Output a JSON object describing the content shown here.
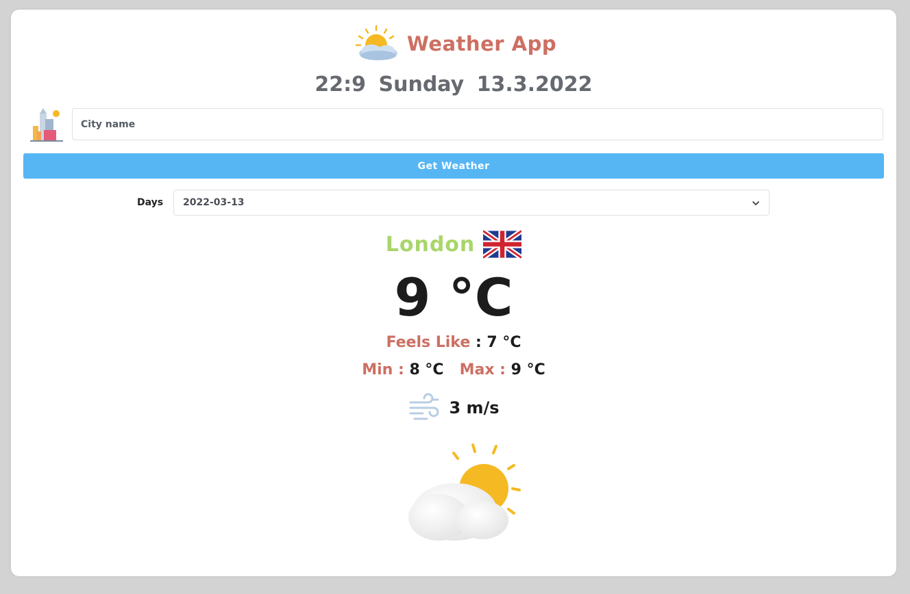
{
  "header": {
    "title": "Weather App",
    "logo_icon": "sun-cloud-icon"
  },
  "datetime": {
    "time": "22:9",
    "day": "Sunday",
    "date": "13.3.2022"
  },
  "search": {
    "icon": "city-buildings-icon",
    "placeholder": "City name",
    "value": ""
  },
  "actions": {
    "get_weather_label": "Get Weather"
  },
  "days": {
    "label": "Days",
    "selected": "2022-03-13"
  },
  "weather": {
    "city": "London",
    "flag_icon": "uk-flag-icon",
    "temperature": "9 °C",
    "feels_like_label": "Feels Like",
    "feels_like_value": ": 7 °C",
    "min_label": "Min :",
    "min_value": "8 °C",
    "max_label": "Max :",
    "max_value": "9 °C",
    "wind_icon": "wind-icon",
    "wind_speed": "3 m/s",
    "condition_icon": "partly-cloudy-icon"
  },
  "colors": {
    "background": "#d3d3d3",
    "card": "#ffffff",
    "title": "#cd6f63",
    "datetime": "#666a70",
    "button": "#56b6f4",
    "city": "#a9d66a",
    "label": "#cd6f63",
    "value": "#1c1c1c"
  }
}
